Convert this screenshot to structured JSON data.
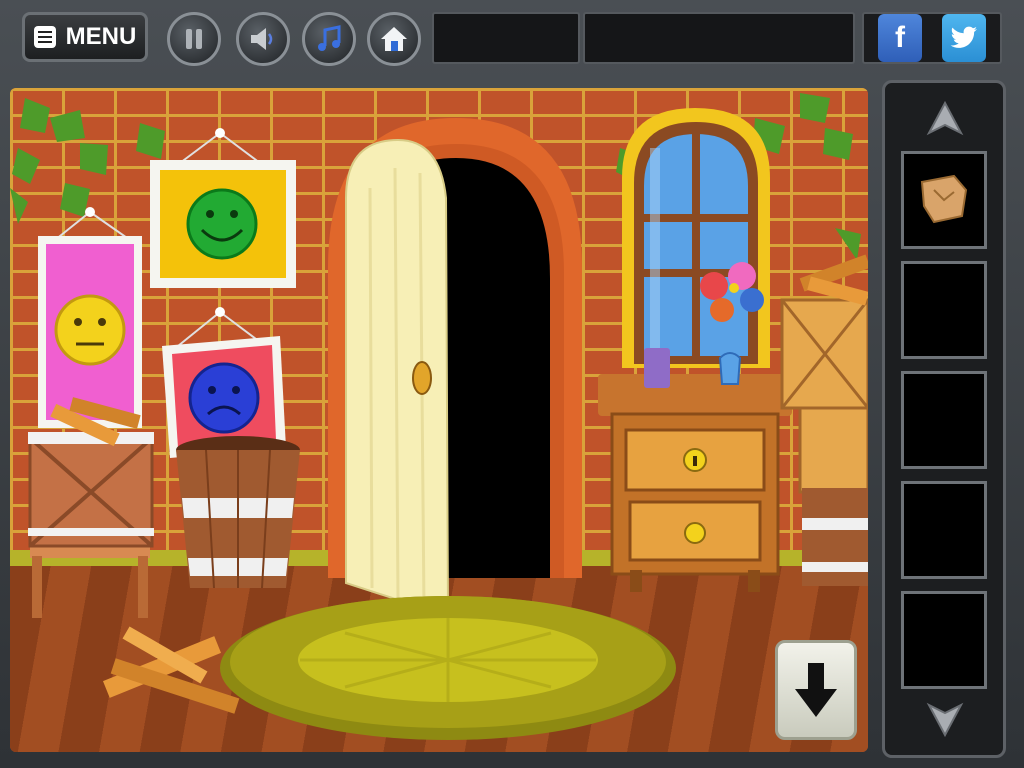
{
  "topbar": {
    "menu_label": "MENU",
    "pause_icon": "pause-icon",
    "sound_icon": "speaker-icon",
    "music_icon": "music-note-icon",
    "home_icon": "home-icon",
    "facebook_label": "f",
    "twitter_icon": "twitter-bird-icon"
  },
  "scene": {
    "faces": [
      {
        "mood": "happy",
        "color": "#22aa33",
        "frame": "#f4c20a"
      },
      {
        "mood": "neutral",
        "color": "#f3d21c",
        "frame": "#f05fd0"
      },
      {
        "mood": "sad",
        "color": "#2a3fd6",
        "frame": "#ef4c5f"
      }
    ],
    "colors": {
      "wall": "#c0532a",
      "mortar": "#d9a33a",
      "rug": "#a7a017",
      "door": "#f7efb6"
    }
  },
  "inventory": {
    "slots": [
      {
        "item": "map-piece-icon"
      },
      {
        "item": ""
      },
      {
        "item": ""
      },
      {
        "item": ""
      },
      {
        "item": ""
      }
    ],
    "up_icon": "arrow-up-icon",
    "down_icon": "arrow-down-icon"
  },
  "navigation": {
    "down_icon": "arrow-down-icon"
  }
}
